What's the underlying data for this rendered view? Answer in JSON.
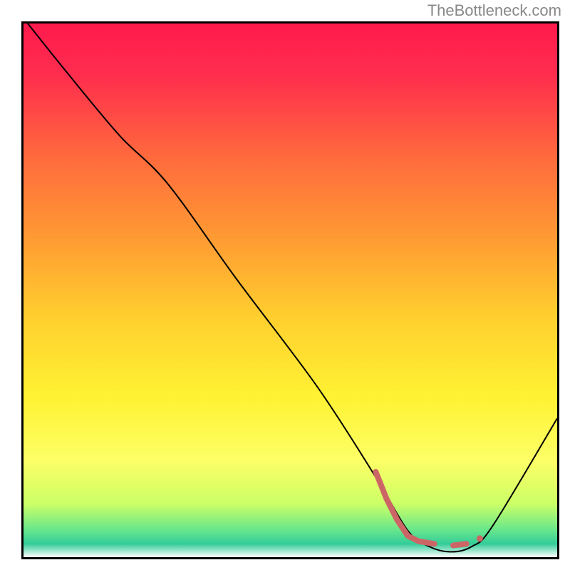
{
  "watermark": "TheBottleneck.com",
  "chart_data": {
    "type": "line",
    "title": "",
    "xlabel": "",
    "ylabel": "",
    "xlim": [
      0,
      100
    ],
    "ylim": [
      0,
      100
    ],
    "series": [
      {
        "name": "bottleneck-curve",
        "x": [
          0,
          8,
          18,
          27,
          40,
          55,
          66,
          72,
          76,
          80,
          84,
          88,
          100
        ],
        "values": [
          101,
          91,
          79,
          70,
          52,
          32,
          15,
          5,
          2,
          1,
          2,
          6,
          26
        ]
      }
    ],
    "highlight_segment": {
      "name": "optimal-range-marker",
      "color": "#cc6666",
      "points": [
        {
          "x": 66,
          "y": 16
        },
        {
          "x": 68,
          "y": 11
        },
        {
          "x": 70,
          "y": 7
        },
        {
          "x": 72,
          "y": 4
        },
        {
          "x": 74,
          "y": 3
        },
        {
          "x": 77,
          "y": 2.5
        },
        {
          "x": 80.5,
          "y": 2.2
        },
        {
          "x": 83,
          "y": 2.5
        },
        {
          "x": 85.5,
          "y": 3.5
        }
      ]
    },
    "background_gradient": {
      "stops": [
        {
          "offset": 0.0,
          "color": "#ff1a4d"
        },
        {
          "offset": 0.1,
          "color": "#ff2e4d"
        },
        {
          "offset": 0.25,
          "color": "#ff6a3d"
        },
        {
          "offset": 0.4,
          "color": "#ff9a33"
        },
        {
          "offset": 0.55,
          "color": "#ffcf2e"
        },
        {
          "offset": 0.7,
          "color": "#fff233"
        },
        {
          "offset": 0.82,
          "color": "#fcff66"
        },
        {
          "offset": 0.9,
          "color": "#ccff66"
        },
        {
          "offset": 0.95,
          "color": "#66e68c"
        },
        {
          "offset": 0.975,
          "color": "#33cc99"
        },
        {
          "offset": 1.0,
          "color": "#ffffff"
        }
      ]
    }
  }
}
